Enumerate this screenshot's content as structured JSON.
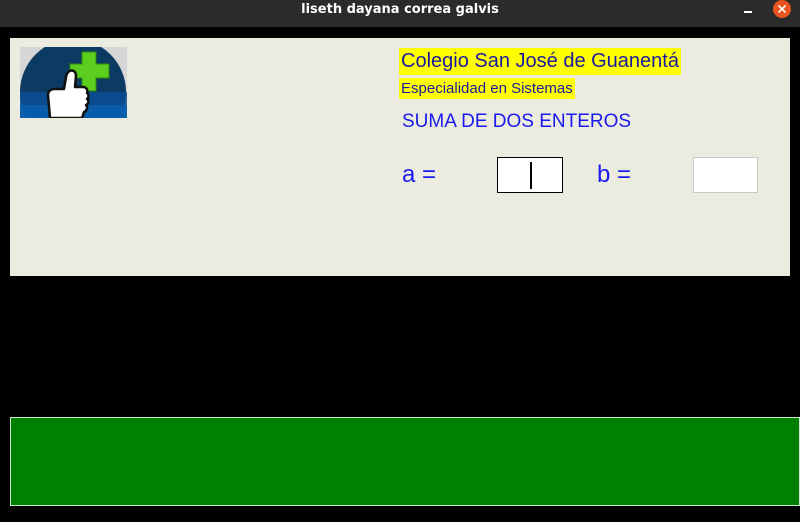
{
  "window": {
    "title": "liseth dayana correa galvis",
    "minimize_icon": "minimize-icon",
    "close_icon": "close-icon",
    "close_color": "#e95420"
  },
  "header": {
    "logo_icon": "thumbs-up-plus-icon",
    "school_name": "Colegio San José de Guanentá",
    "specialty": "Especialidad en Sistemas",
    "highlight_color": "#ffff00"
  },
  "form": {
    "heading": "SUMA DE DOS ENTEROS",
    "label_a": "a =",
    "value_a": "",
    "label_b": "b =",
    "value_b": ""
  },
  "result": {
    "text": "",
    "color": "#008000"
  }
}
